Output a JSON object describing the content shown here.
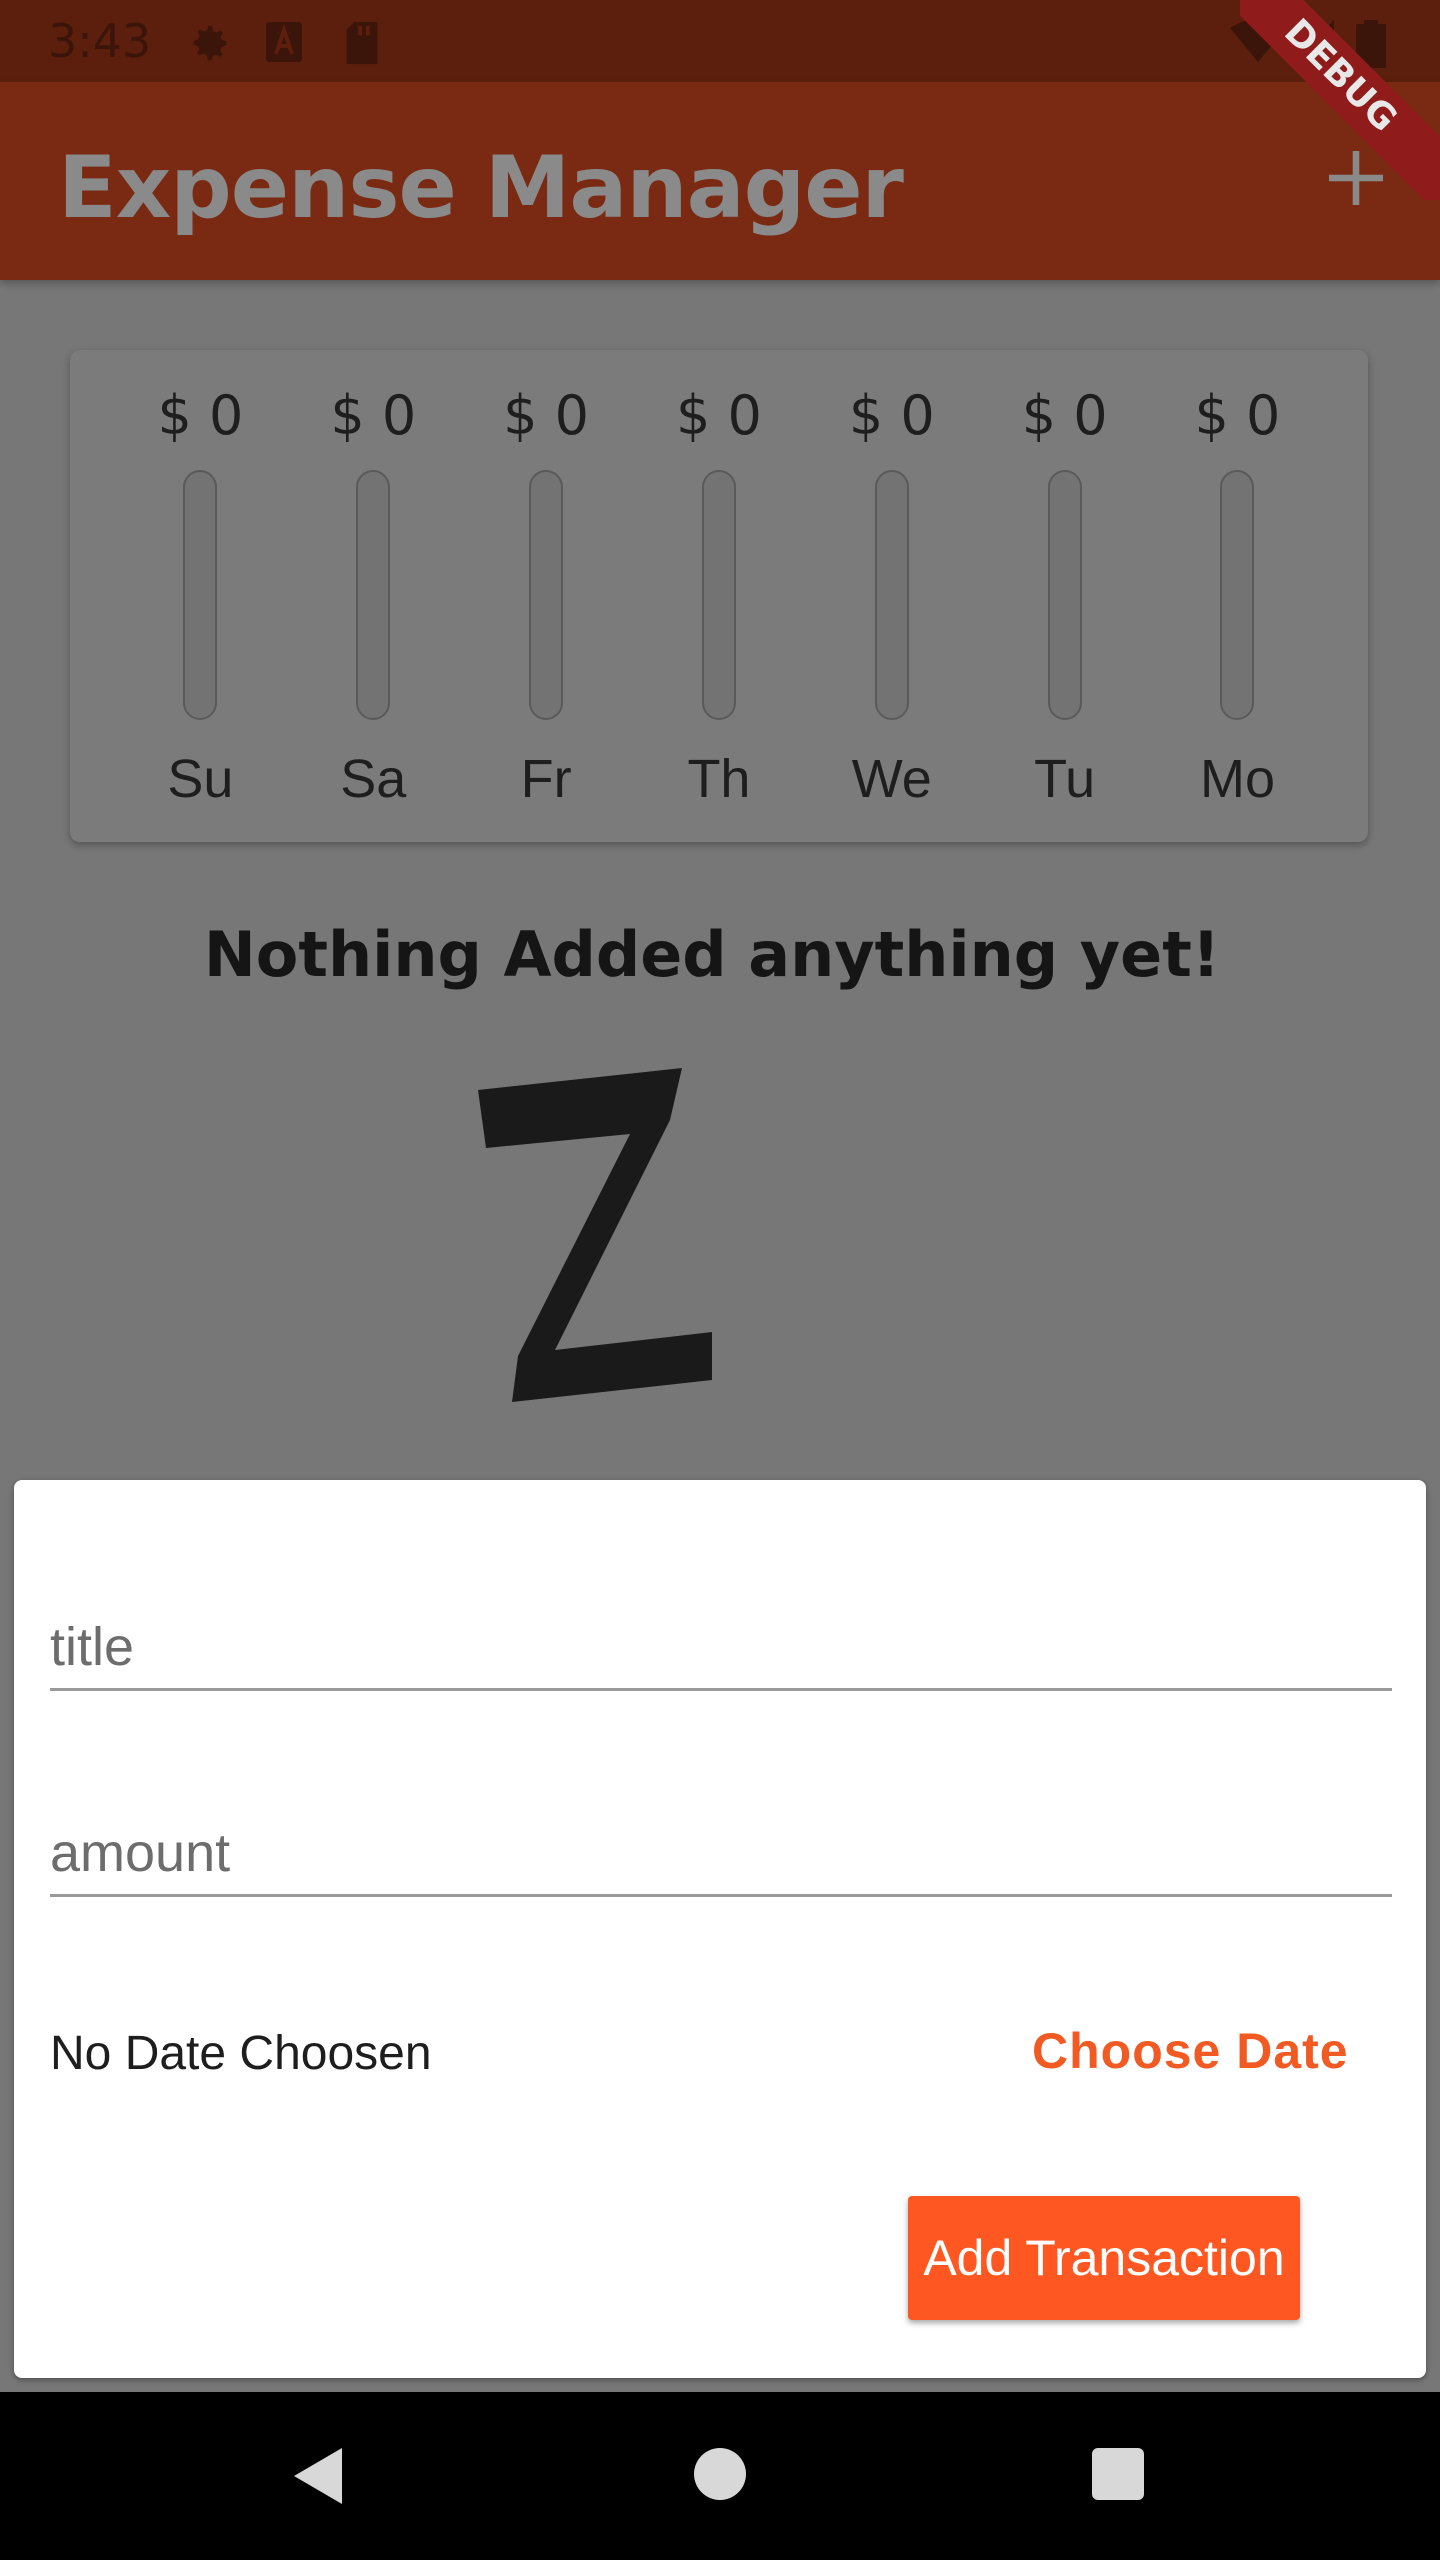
{
  "status_bar": {
    "time": "3:43",
    "icons": [
      "settings-icon",
      "a-icon",
      "sd-card-icon",
      "wifi-icon",
      "signal-icon",
      "battery-icon"
    ]
  },
  "app_bar": {
    "title": "Expense Manager",
    "action_icon": "plus-icon",
    "debug_label": "DEBUG"
  },
  "chart": {
    "bars": [
      {
        "day": "Su",
        "amount": "$ 0",
        "fill": 0
      },
      {
        "day": "Sa",
        "amount": "$ 0",
        "fill": 0
      },
      {
        "day": "Fr",
        "amount": "$ 0",
        "fill": 0
      },
      {
        "day": "Th",
        "amount": "$ 0",
        "fill": 0
      },
      {
        "day": "We",
        "amount": "$ 0",
        "fill": 0
      },
      {
        "day": "Tu",
        "amount": "$ 0",
        "fill": 0
      },
      {
        "day": "Mo",
        "amount": "$ 0",
        "fill": 0
      }
    ]
  },
  "empty_state": {
    "message": "Nothing Added anything yet!",
    "image": "zz-sleep-image"
  },
  "form": {
    "title_placeholder": "title",
    "amount_placeholder": "amount",
    "date_label": "No Date Choosen",
    "choose_date_label": "Choose Date",
    "submit_label": "Add Transaction"
  },
  "nav": {
    "icons": [
      "back-icon",
      "home-icon",
      "recents-icon"
    ]
  },
  "colors": {
    "accent": "#ff5722",
    "app_bar": "#7a2a12",
    "status_bar": "#5c1f0d"
  }
}
